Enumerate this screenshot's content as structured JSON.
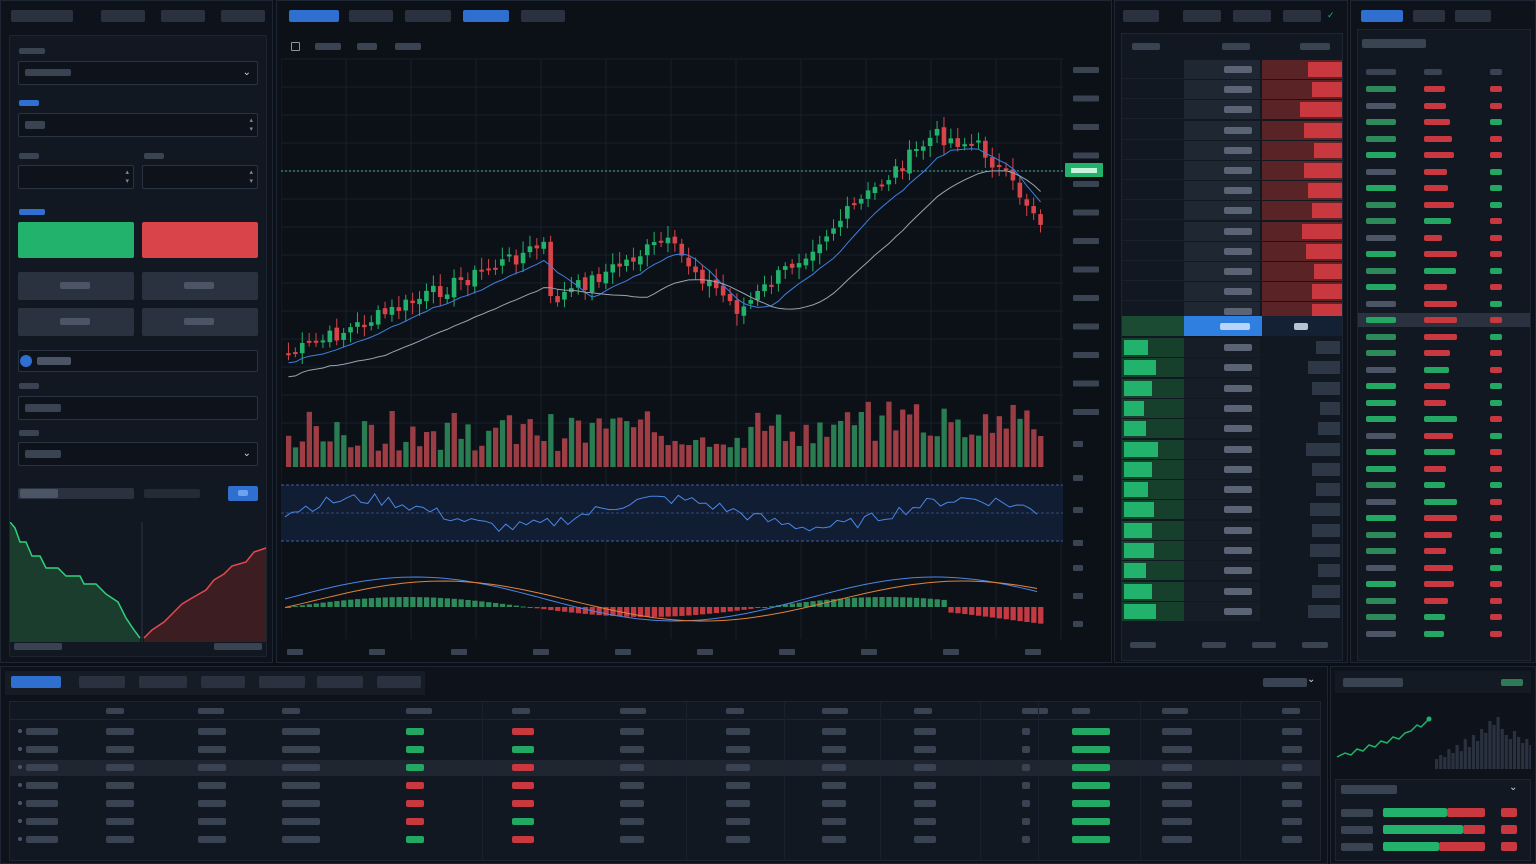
{
  "colors": {
    "bg": "#0b0f16",
    "panel": "#11161f",
    "green": "#23b26b",
    "red": "#d9434a",
    "blue": "#2f6fd0",
    "grey": "#3a4352"
  },
  "left_panel": {
    "labels": [
      "",
      "",
      "",
      "",
      "",
      ""
    ],
    "buy_button": "",
    "sell_button": "",
    "toggle_label": "",
    "icons": [
      "chevron-down-icon",
      "stepper-icon",
      "toggle-icon"
    ]
  },
  "chart_panel": {
    "tabs": [
      "",
      "",
      "",
      "",
      ""
    ],
    "active_tab_index": 0,
    "checkbox_checked": false,
    "price_tag": "",
    "candle_trend": "uptrend then pullback"
  },
  "order_book": {
    "header": [
      "",
      "",
      ""
    ],
    "spread_label": "",
    "asks_rows": 13,
    "bids_rows": 14
  },
  "trades_panel": {
    "tabs": [
      "",
      "",
      ""
    ],
    "rows": 34
  },
  "bottom_table": {
    "tabs": [
      "",
      "",
      "",
      "",
      "",
      "",
      ""
    ],
    "active_tab_index": 0,
    "rows": 7,
    "selected_row_index": 2
  },
  "mini_panel": {
    "title": "",
    "sub_title": ""
  }
}
